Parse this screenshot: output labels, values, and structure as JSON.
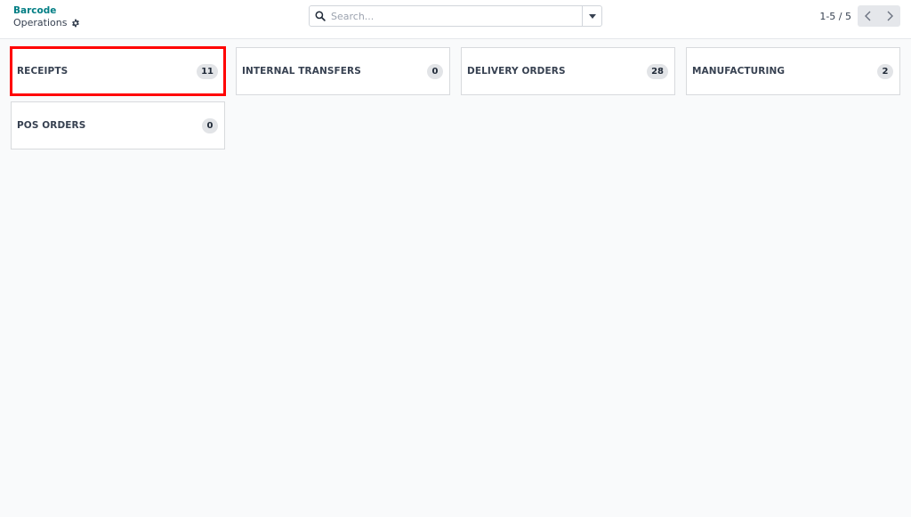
{
  "breadcrumb": {
    "parent": "Barcode",
    "current": "Operations"
  },
  "search": {
    "placeholder": "Search...",
    "value": ""
  },
  "pager": {
    "value": "1-5 / 5"
  },
  "operations": [
    {
      "label": "RECEIPTS",
      "count": "11"
    },
    {
      "label": "INTERNAL TRANSFERS",
      "count": "0"
    },
    {
      "label": "DELIVERY ORDERS",
      "count": "28"
    },
    {
      "label": "MANUFACTURING",
      "count": "2"
    },
    {
      "label": "POS ORDERS",
      "count": "0"
    }
  ],
  "colors": {
    "accent": "#017e84",
    "highlight": "#ff0000",
    "background": "#f9fafb"
  },
  "icons": {
    "settings": "gear-icon",
    "search": "search-icon",
    "dropdown": "caret-down-icon",
    "previous": "chevron-left-icon",
    "next": "chevron-right-icon"
  }
}
